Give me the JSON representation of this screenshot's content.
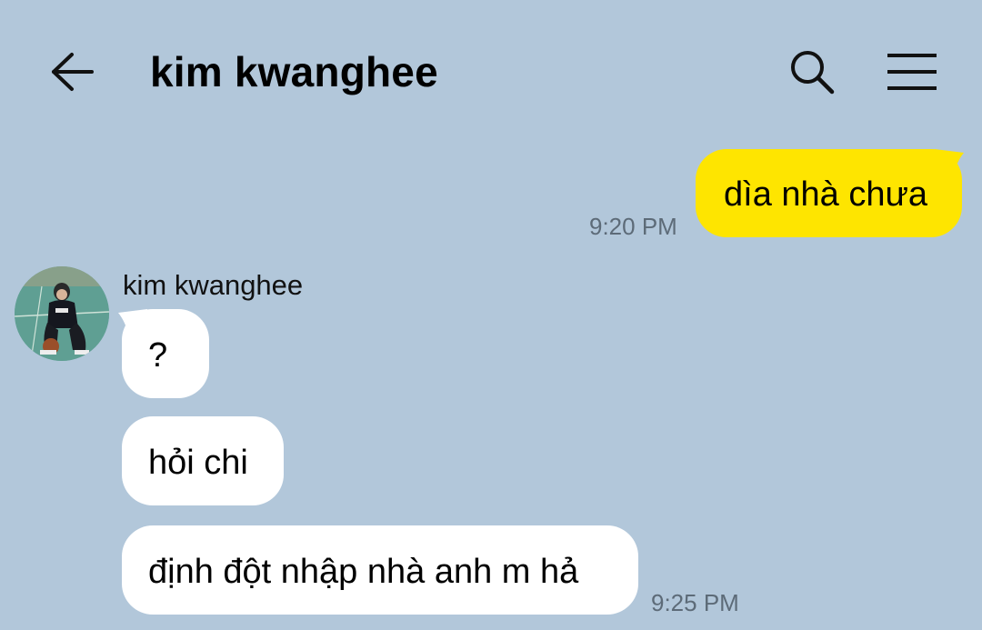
{
  "header": {
    "title": "kim kwanghee",
    "back_icon": "arrow-left-icon",
    "search_icon": "search-icon",
    "menu_icon": "hamburger-menu-icon"
  },
  "colors": {
    "background": "#b2c7da",
    "my_bubble": "#fee500",
    "their_bubble": "#ffffff",
    "timestamp": "#5d6b78"
  },
  "messages": {
    "outgoing": [
      {
        "text": "dìa nhà chưa",
        "time": "9:20 PM"
      }
    ],
    "incoming": {
      "sender": "kim kwanghee",
      "items": [
        {
          "text": "?"
        },
        {
          "text": "hỏi chi"
        },
        {
          "text": "định đột nhập nhà anh m hả",
          "time": "9:25 PM"
        }
      ]
    }
  }
}
